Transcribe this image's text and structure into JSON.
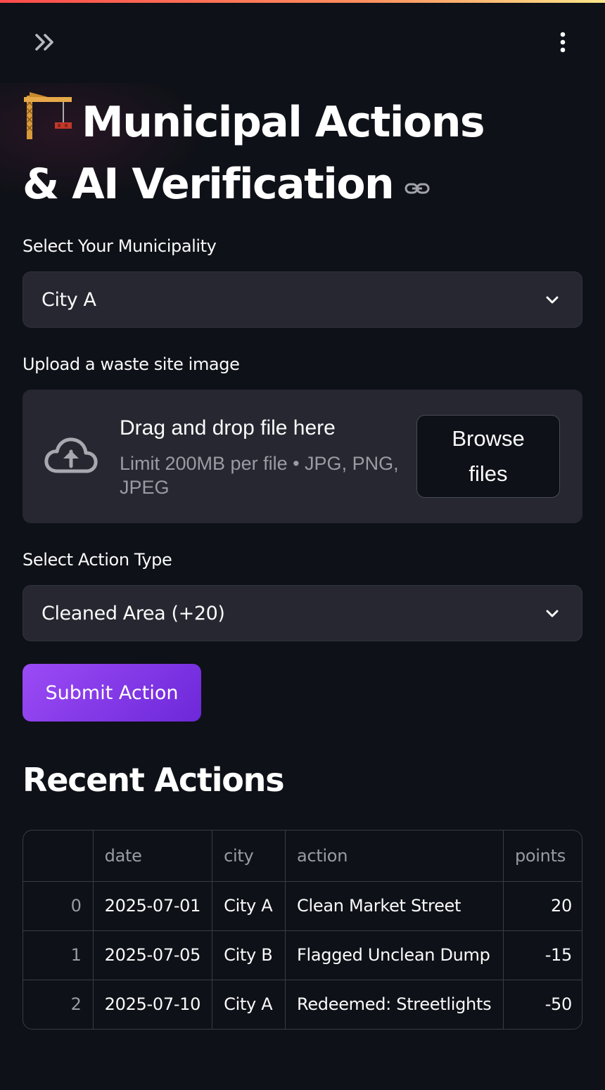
{
  "header": {
    "expand_icon": "double-chevron-right-icon",
    "menu_icon": "vertical-ellipsis-icon"
  },
  "page": {
    "title_icon": "construction-crane-emoji",
    "title": "Municipal Actions & AI Verification",
    "anchor_icon": "link-icon"
  },
  "municipality": {
    "label": "Select Your Municipality",
    "selected": "City A"
  },
  "upload": {
    "label": "Upload a waste site image",
    "dropzone_title": "Drag and drop file here",
    "dropzone_hint": "Limit 200MB per file • JPG, PNG, JPEG",
    "browse_label": "Browse files",
    "icon": "cloud-upload-icon"
  },
  "action_type": {
    "label": "Select Action Type",
    "selected": "Cleaned Area (+20)"
  },
  "submit": {
    "label": "Submit Action"
  },
  "recent": {
    "heading": "Recent Actions",
    "columns": [
      "",
      "date",
      "city",
      "action",
      "points"
    ],
    "rows": [
      {
        "index": "0",
        "date": "2025-07-01",
        "city": "City A",
        "action": "Clean Market Street",
        "points": "20"
      },
      {
        "index": "1",
        "date": "2025-07-05",
        "city": "City B",
        "action": "Flagged Unclean Dump",
        "points": "-15"
      },
      {
        "index": "2",
        "date": "2025-07-10",
        "city": "City A",
        "action": "Redeemed: Streetlights",
        "points": "-50"
      }
    ]
  },
  "colors": {
    "background": "#0e1117",
    "surface": "#262730",
    "accent_start": "#9b4bf5",
    "accent_end": "#6d28d9",
    "muted_text": "#9a9ba3"
  }
}
